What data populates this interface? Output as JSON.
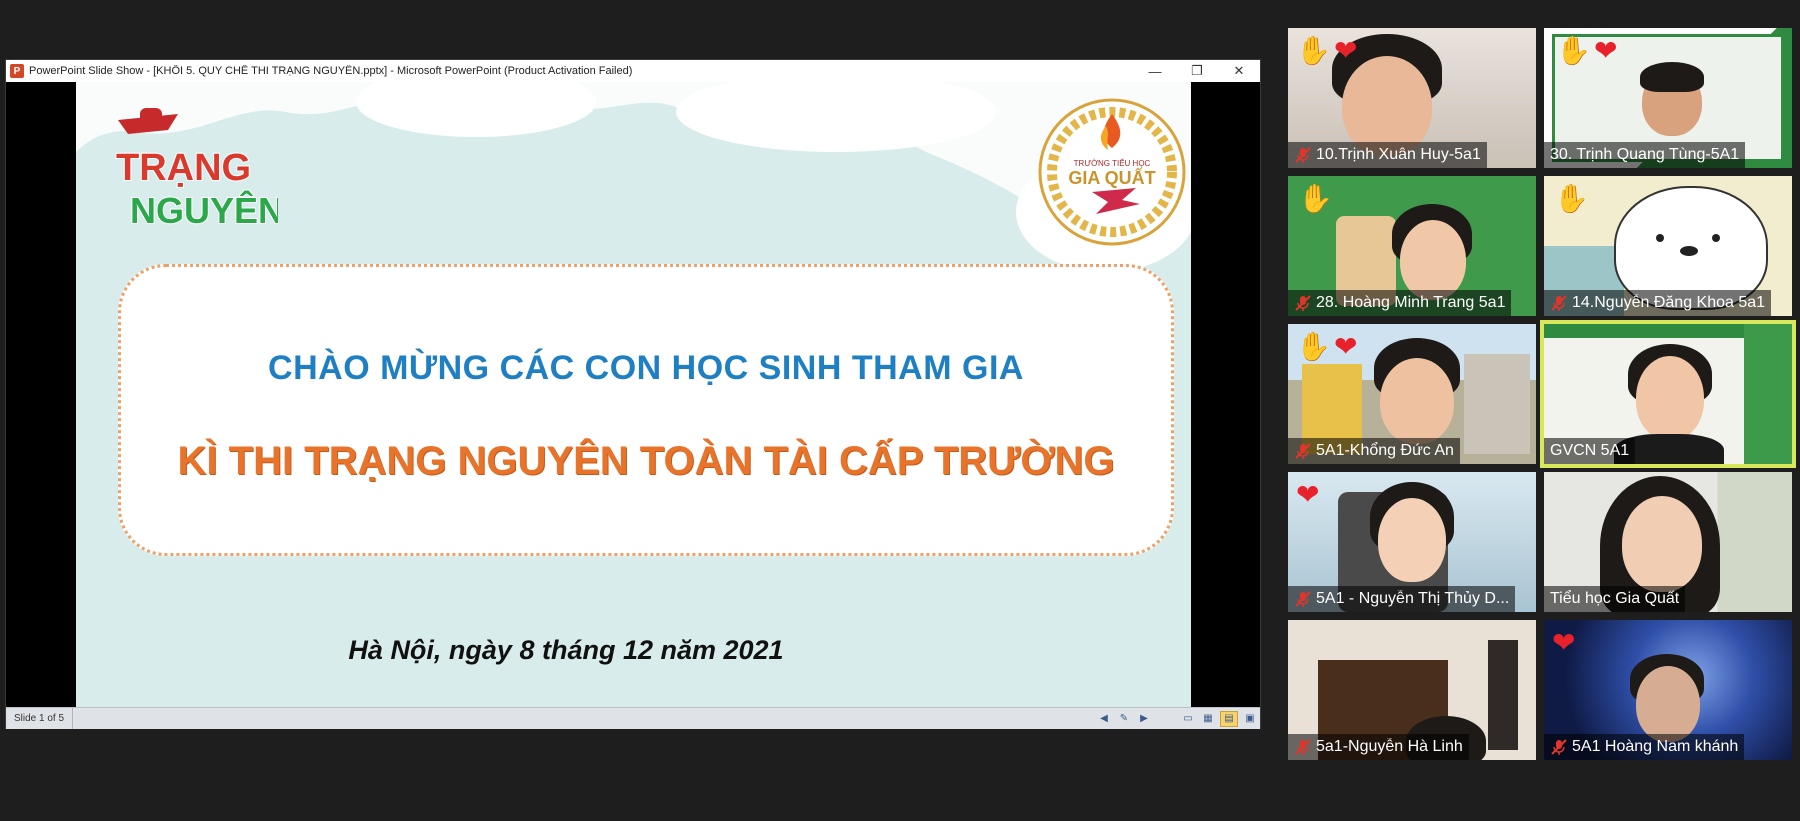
{
  "ppt": {
    "title": "PowerPoint Slide Show - [KHỐI 5. QUY CHẾ THI TRẠNG NGUYÊN.pptx] - Microsoft PowerPoint (Product Activation Failed)",
    "app_icon_letter": "P",
    "window_buttons": {
      "minimize": "—",
      "restore": "❐",
      "close": "✕"
    },
    "status": {
      "slide_counter": "Slide 1 of 5"
    },
    "slide": {
      "logo_left_text": [
        "TRẠNG",
        "NGUYÊN"
      ],
      "logo_right_text": {
        "top": "TRƯỜNG TIỂU HỌC",
        "main": "GIA QUẤT"
      },
      "welcome_line1": "CHÀO MỪNG CÁC CON HỌC SINH THAM GIA",
      "welcome_line2": "KÌ THI TRẠNG NGUYÊN TOÀN TÀI CẤP TRƯỜNG",
      "date_line": "Hà Nội, ngày 8 tháng 12 năm 2021"
    }
  },
  "participants": [
    {
      "name": "10.Trịnh Xuân Huy-5a1",
      "reactions": [
        "hand",
        "heart"
      ],
      "muted": true
    },
    {
      "name": "30. Trịnh Quang Tùng-5A1",
      "reactions": [
        "hand",
        "heart"
      ],
      "muted": false
    },
    {
      "name": "28. Hoàng Minh Trang 5a1",
      "reactions": [
        "hand"
      ],
      "muted": true
    },
    {
      "name": "14.Nguyễn Đăng Khoa 5a1",
      "reactions": [
        "hand"
      ],
      "muted": true
    },
    {
      "name": "5A1-Khổng Đức An",
      "reactions": [
        "hand-light",
        "heart"
      ],
      "muted": true
    },
    {
      "name": "GVCN 5A1",
      "reactions": [],
      "muted": false,
      "active_speaker": true
    },
    {
      "name": "5A1 - Nguyễn Thị Thủy D...",
      "reactions": [
        "heart"
      ],
      "muted": true
    },
    {
      "name": "Tiểu học Gia Quất",
      "reactions": [],
      "muted": false
    },
    {
      "name": "5a1-Nguyễn Hà Linh",
      "reactions": [],
      "muted": true
    },
    {
      "name": "5A1 Hoàng Nam khánh",
      "reactions": [
        "heart"
      ],
      "muted": true
    }
  ],
  "colors": {
    "welcome_blue": "#1e7fc3",
    "welcome_orange": "#e8742b",
    "active_speaker_border": "#d9e85a",
    "mic_off_red": "#e0352b"
  }
}
